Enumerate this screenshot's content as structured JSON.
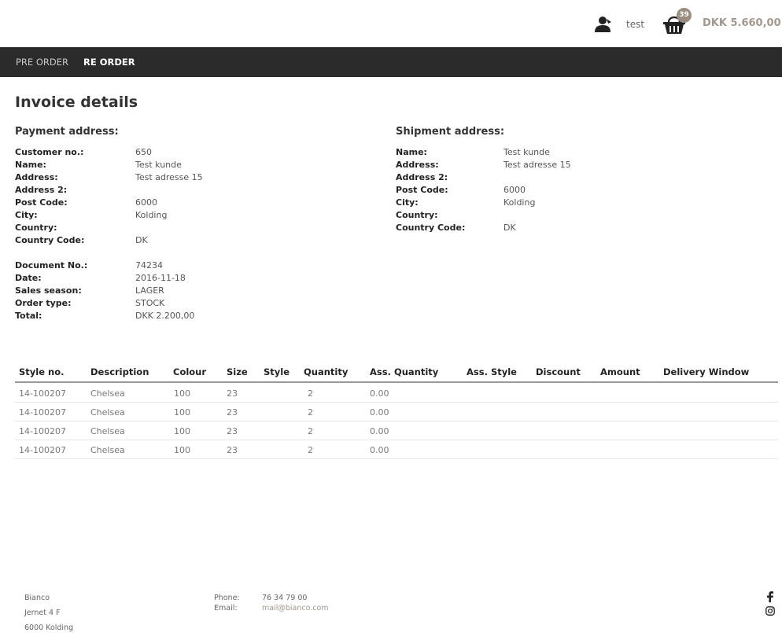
{
  "header": {
    "user_name": "test",
    "cart_count": "39",
    "cart_total": "DKK 5.660,00"
  },
  "nav": {
    "items": [
      {
        "label": "PRE ORDER"
      },
      {
        "label": "RE ORDER"
      }
    ]
  },
  "page": {
    "title": "Invoice details"
  },
  "payment": {
    "title": "Payment address:",
    "rows": [
      {
        "label": "Customer no.:",
        "value": "650"
      },
      {
        "label": "Name:",
        "value": "Test kunde"
      },
      {
        "label": "Address:",
        "value": "Test adresse 15"
      },
      {
        "label": "Address 2:",
        "value": ""
      },
      {
        "label": "Post Code:",
        "value": "6000"
      },
      {
        "label": "City:",
        "value": "Kolding"
      },
      {
        "label": "Country:",
        "value": ""
      },
      {
        "label": "Country Code:",
        "value": "DK"
      }
    ]
  },
  "document": {
    "rows": [
      {
        "label": "Document No.:",
        "value": "74234"
      },
      {
        "label": "Date:",
        "value": "2016-11-18"
      },
      {
        "label": "Sales season:",
        "value": "LAGER"
      },
      {
        "label": "Order type:",
        "value": "STOCK"
      },
      {
        "label": "Total:",
        "value": "DKK 2.200,00"
      }
    ]
  },
  "shipment": {
    "title": "Shipment address:",
    "rows": [
      {
        "label": "Name:",
        "value": "Test kunde"
      },
      {
        "label": "Address:",
        "value": "Test adresse 15"
      },
      {
        "label": "Address 2:",
        "value": ""
      },
      {
        "label": "Post Code:",
        "value": "6000"
      },
      {
        "label": "City:",
        "value": "Kolding"
      },
      {
        "label": "Country:",
        "value": ""
      },
      {
        "label": "Country Code:",
        "value": "DK"
      }
    ]
  },
  "table": {
    "columns": [
      "Style no.",
      "Description",
      "Colour",
      "Size",
      "Style",
      "Quantity",
      "Ass. Quantity",
      "Ass. Style",
      "Discount",
      "Amount",
      "Delivery Window"
    ],
    "rows": [
      [
        "14-100207",
        "Chelsea",
        "100",
        "23",
        "",
        "2",
        "0.00",
        "",
        "",
        "",
        ""
      ],
      [
        "14-100207",
        "Chelsea",
        "100",
        "23",
        "",
        "2",
        "0.00",
        "",
        "",
        "",
        ""
      ],
      [
        "14-100207",
        "Chelsea",
        "100",
        "23",
        "",
        "2",
        "0.00",
        "",
        "",
        "",
        ""
      ],
      [
        "14-100207",
        "Chelsea",
        "100",
        "23",
        "",
        "2",
        "0.00",
        "",
        "",
        "",
        ""
      ]
    ]
  },
  "footer": {
    "company": "Bianco",
    "street": "Jernet 4 F",
    "city": "6000 Kolding",
    "phone_label": "Phone:",
    "phone": "76 34 79 00",
    "email_label": "Email:",
    "email": "mail@bianco.com"
  },
  "icons": {
    "user": "user-icon",
    "basket": "basket-icon",
    "facebook": "facebook-icon",
    "instagram": "instagram-icon"
  },
  "colors": {
    "nav_bg": "#2b2b2b",
    "accent": "#a4988d",
    "badge": "#9a8d80"
  }
}
